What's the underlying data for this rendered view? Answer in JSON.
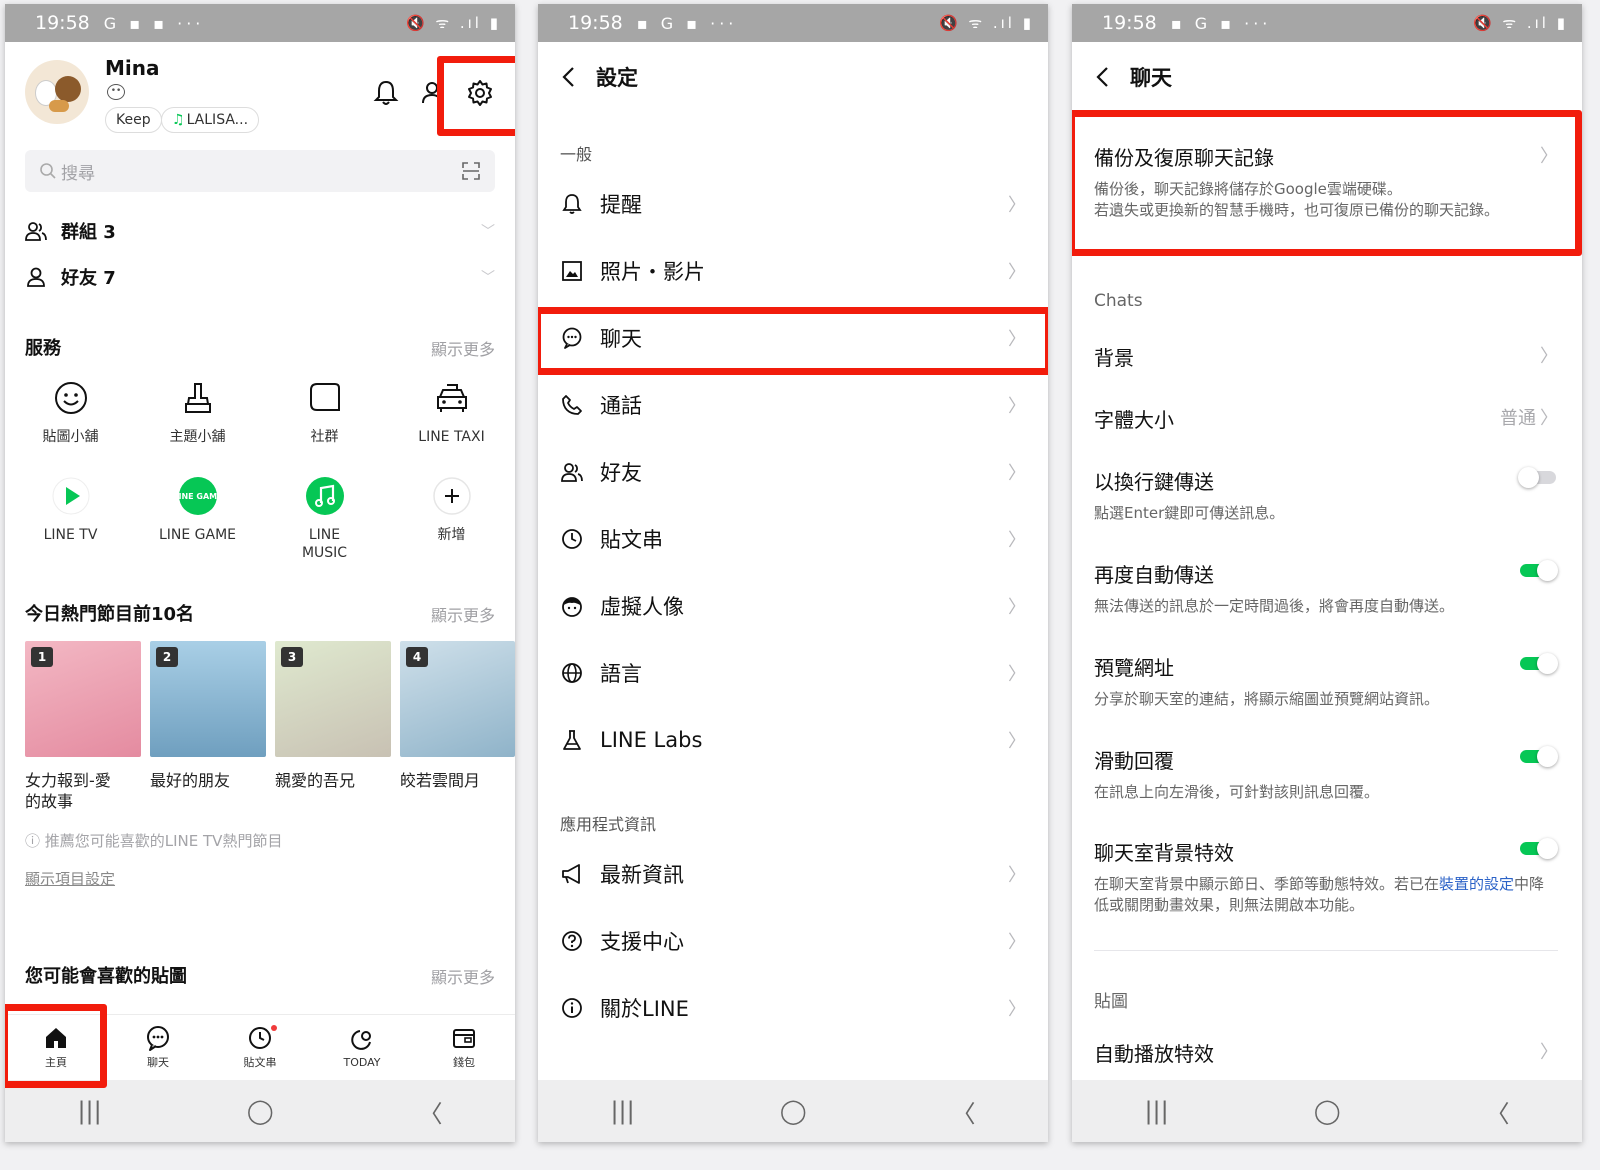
{
  "statusbar": {
    "time": "19:58",
    "icons_left_1": "G ▪ ▪ ···",
    "icons_left_2": "▪ G ▪ ···",
    "icons_right": "🔇 ᯤ .ıl ▮"
  },
  "home": {
    "user_name": "Mina",
    "pill_keep": "Keep",
    "pill_music": "LALISA...",
    "search_placeholder": "搜尋",
    "groups_label": "群組 3",
    "friends_label": "好友 7",
    "services_title": "服務",
    "show_more": "顯示更多",
    "services": [
      {
        "label": "貼圖小舖",
        "icon": "smiley-icon"
      },
      {
        "label": "主題小舖",
        "icon": "brush-icon"
      },
      {
        "label": "社群",
        "icon": "chat-bubble-icon"
      },
      {
        "label": "LINE TAXI",
        "icon": "taxi-icon"
      },
      {
        "label": "LINE TV",
        "icon": "play-icon"
      },
      {
        "label": "LINE GAME",
        "icon": "line-game-icon"
      },
      {
        "label": "LINE\nMUSIC",
        "icon": "music-icon"
      },
      {
        "label": "新增",
        "icon": "plus-icon"
      }
    ],
    "line_game_logo_text": "LINE GAME",
    "trending_title": "今日熱門節目前10名",
    "shows": [
      {
        "rank": "1",
        "title": "女力報到-愛的故事",
        "color1": "#f3b8c4",
        "color2": "#e48ba0"
      },
      {
        "rank": "2",
        "title": "最好的朋友",
        "color1": "#a9cfe6",
        "color2": "#6f9fbf"
      },
      {
        "rank": "3",
        "title": "親愛的吾兄",
        "color1": "#dfe9cf",
        "color2": "#c8c1b3"
      },
      {
        "rank": "4",
        "title": "皎若雲間月",
        "color1": "#cfe0ea",
        "color2": "#8fb3c9"
      }
    ],
    "hint": "ⓘ 推薦您可能喜歡的LINE TV熱門節目",
    "display_settings_link": "顯示項目設定",
    "stickers_title": "您可能會喜歡的貼圖",
    "tabs": [
      {
        "label": "主頁",
        "icon": "home-icon"
      },
      {
        "label": "聊天",
        "icon": "chat-icon"
      },
      {
        "label": "貼文串",
        "icon": "timeline-icon"
      },
      {
        "label": "TODAY",
        "icon": "today-icon"
      },
      {
        "label": "錢包",
        "icon": "wallet-icon"
      }
    ]
  },
  "settings": {
    "title": "設定",
    "group_general": "一般",
    "items_general": [
      {
        "label": "提醒",
        "icon": "bell-icon"
      },
      {
        "label": "照片・影片",
        "icon": "photo-icon"
      },
      {
        "label": "聊天",
        "icon": "chat-icon"
      },
      {
        "label": "通話",
        "icon": "phone-icon"
      },
      {
        "label": "好友",
        "icon": "friends-icon"
      },
      {
        "label": "貼文串",
        "icon": "clock-icon"
      },
      {
        "label": "虛擬人像",
        "icon": "avatar-face-icon"
      },
      {
        "label": "語言",
        "icon": "globe-icon"
      },
      {
        "label": "LINE Labs",
        "icon": "flask-icon"
      }
    ],
    "group_app": "應用程式資訊",
    "items_app": [
      {
        "label": "最新資訊",
        "icon": "megaphone-icon"
      },
      {
        "label": "支援中心",
        "icon": "help-icon"
      },
      {
        "label": "關於LINE",
        "icon": "info-icon"
      }
    ]
  },
  "chat_settings": {
    "title": "聊天",
    "backup_title": "備份及復原聊天記錄",
    "backup_desc": "備份後，聊天記錄將儲存於Google雲端硬碟。\n若遺失或更換新的智慧手機時，也可復原已備份的聊天記錄。",
    "group_chats": "Chats",
    "background_label": "背景",
    "font_size_label": "字體大小",
    "font_size_value": "普通",
    "enter_send_title": "以換行鍵傳送",
    "enter_send_desc": "點選Enter鍵即可傳送訊息。",
    "auto_resend_title": "再度自動傳送",
    "auto_resend_desc": "無法傳送的訊息於一定時間過後，將會再度自動傳送。",
    "preview_title": "預覽網址",
    "preview_desc": "分享於聊天室的連結，將顯示縮圖並預覽網站資訊。",
    "swipe_title": "滑動回覆",
    "swipe_desc": "在訊息上向左滑後，可針對該則訊息回覆。",
    "effects_title": "聊天室背景特效",
    "effects_desc_1": "在聊天室背景中顯示節日、季節等動態特效。若已在",
    "effects_desc_link": "裝置的設定",
    "effects_desc_2": "中降低或關閉動畫效果，則無法開啟本功能。",
    "group_stickers": "貼圖",
    "autoplay_title": "自動播放特效"
  },
  "colors": {
    "accent": "#06c755",
    "highlight": "#f21c0c",
    "link": "#2b62c7"
  }
}
